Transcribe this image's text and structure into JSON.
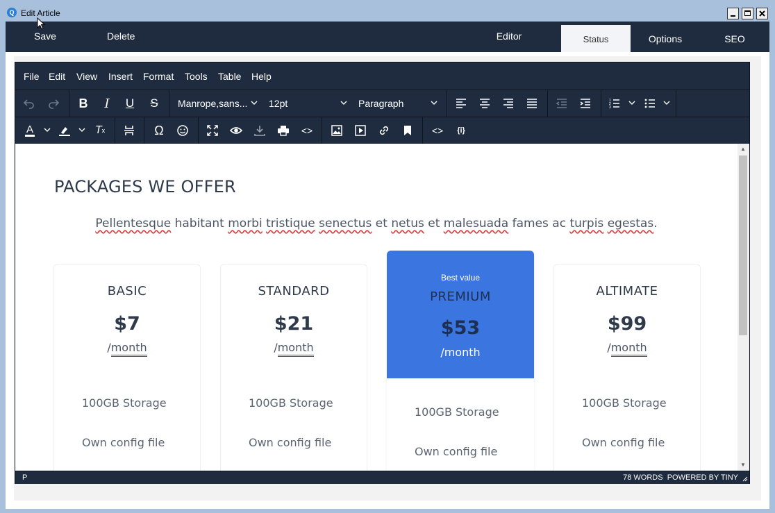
{
  "window": {
    "title": "Edit Article",
    "app_icon": "app-logo-icon"
  },
  "appbar": {
    "save": "Save",
    "delete": "Delete",
    "tabs": [
      {
        "label": "Editor",
        "active": false
      },
      {
        "label": "Status",
        "active": true
      },
      {
        "label": "Options",
        "active": false
      },
      {
        "label": "SEO",
        "active": false
      }
    ]
  },
  "editor": {
    "menu": [
      "File",
      "Edit",
      "View",
      "Insert",
      "Format",
      "Tools",
      "Table",
      "Help"
    ],
    "font_family": "Manrope,sans...",
    "font_size": "12pt",
    "block_format": "Paragraph"
  },
  "document": {
    "heading": "PACKAGES WE OFFER",
    "lead": [
      "Pellentesque",
      " habitant ",
      "morbi",
      " ",
      "tristique",
      " ",
      "senectus",
      " et ",
      "netus",
      " et ",
      "malesuada",
      " fames ac ",
      "turpis",
      " ",
      "egestas",
      "."
    ],
    "packages": [
      {
        "name": "BASIC",
        "price": "$7",
        "period_prefix": "/",
        "period": "month",
        "features": [
          "100GB Storage",
          "Own config file"
        ]
      },
      {
        "name": "STANDARD",
        "price": "$21",
        "period_prefix": "/",
        "period": "month",
        "features": [
          "100GB Storage",
          "Own config file"
        ]
      },
      {
        "badge": "Best value",
        "name": "PREMIUM",
        "price": "$53",
        "period": "/month",
        "features": [
          "100GB Storage",
          "Own config file"
        ]
      },
      {
        "name": "ALTIMATE",
        "price": "$99",
        "period_prefix": "/",
        "period": "month",
        "features": [
          "100GB Storage",
          "Own config file"
        ]
      }
    ]
  },
  "statusbar": {
    "path": "P",
    "words": "78 WORDS",
    "powered": "POWERED BY TINY"
  },
  "colors": {
    "dark": "#1f2c3f",
    "accent": "#3b76e0",
    "spellcheck": "#e04040"
  }
}
